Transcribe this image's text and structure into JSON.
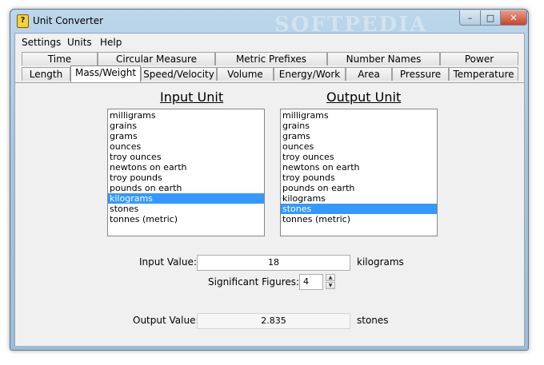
{
  "window": {
    "title": "Unit Converter",
    "minimize": "–",
    "maximize": "□",
    "close": "✕",
    "icon_glyph": "?"
  },
  "watermark": "SOFTPEDIA",
  "menu": [
    "Settings",
    "Units",
    "Help"
  ],
  "tabs_row1": [
    "Time",
    "Circular Measure",
    "Metric Prefixes",
    "Number Names",
    "Power"
  ],
  "tabs_row2": [
    "Length",
    "Mass/Weight",
    "Speed/Velocity",
    "Volume",
    "Energy/Work",
    "Area",
    "Pressure",
    "Temperature"
  ],
  "active_tab": "Mass/Weight",
  "input_unit": {
    "heading": "Input Unit",
    "items": [
      "milligrams",
      "grains",
      "grams",
      "ounces",
      "troy ounces",
      "newtons on earth",
      "troy pounds",
      "pounds on earth",
      "kilograms",
      "stones",
      "tonnes (metric)"
    ],
    "selected": "kilograms"
  },
  "output_unit": {
    "heading": "Output Unit",
    "items": [
      "milligrams",
      "grains",
      "grams",
      "ounces",
      "troy ounces",
      "newtons on earth",
      "troy pounds",
      "pounds on earth",
      "kilograms",
      "stones",
      "tonnes (metric)"
    ],
    "selected": "stones"
  },
  "input_value": {
    "label": "Input Value:",
    "value": "18",
    "unit": "kilograms"
  },
  "sig_figs": {
    "label": "Significant Figures:",
    "value": "4",
    "up": "▲",
    "down": "▼"
  },
  "output_value": {
    "label": "Output Value:",
    "value": "2.835",
    "unit": "stones"
  }
}
